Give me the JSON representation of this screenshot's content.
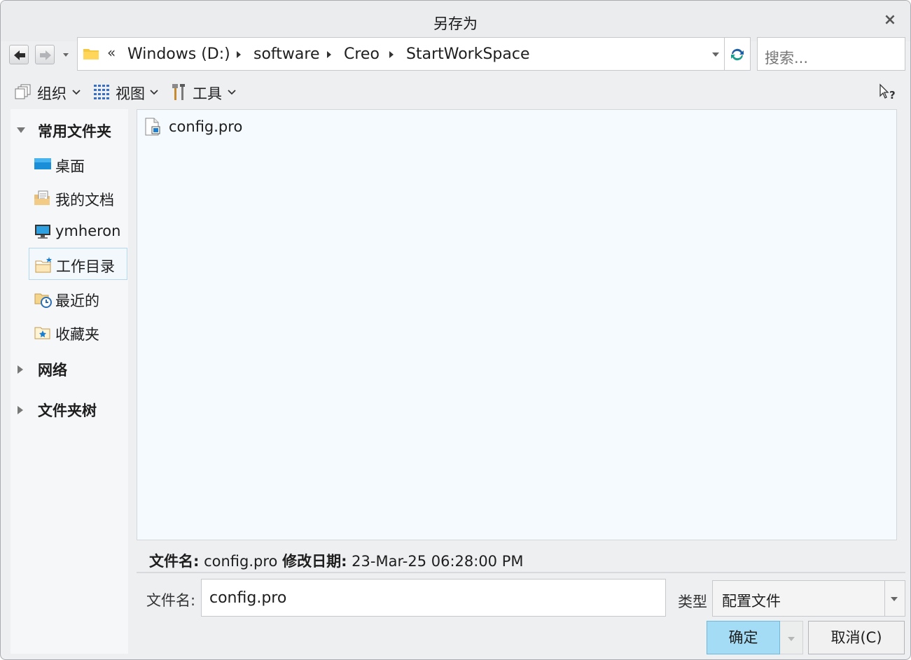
{
  "window": {
    "title": "另存为",
    "close_label": "×"
  },
  "address": {
    "overflow": "«",
    "crumbs": [
      "Windows (D:)",
      "software",
      "Creo",
      "StartWorkSpace"
    ]
  },
  "search": {
    "placeholder": "搜索..."
  },
  "toolbar": {
    "organize": "组织",
    "view": "视图",
    "tools": "工具"
  },
  "sidebar": {
    "favorites_header": "常用文件夹",
    "items": [
      {
        "label": "桌面",
        "icon": "desktop-icon"
      },
      {
        "label": "我的文档",
        "icon": "documents-icon"
      },
      {
        "label": "ymheron",
        "icon": "computer-icon"
      },
      {
        "label": "工作目录",
        "icon": "working-directory-icon"
      },
      {
        "label": "最近的",
        "icon": "recent-icon"
      },
      {
        "label": "收藏夹",
        "icon": "favorites-icon"
      }
    ],
    "network_header": "网络",
    "folder_tree_header": "文件夹树"
  },
  "files": [
    {
      "name": "config.pro",
      "icon": "file-icon"
    }
  ],
  "info": {
    "name_label": "文件名:",
    "name_value": "config.pro",
    "date_label": "修改日期:",
    "date_value": "23-Mar-25 06:28:00 PM"
  },
  "form": {
    "filename_label": "文件名:",
    "filename_value": "config.pro",
    "type_label": "类型",
    "type_value": "配置文件"
  },
  "buttons": {
    "ok": "确定",
    "cancel": "取消(C)"
  },
  "colors": {
    "ok_button": "#a5dcf5",
    "file_list_bg": "#f4fafd",
    "selected_border": "#b6d5ee"
  }
}
